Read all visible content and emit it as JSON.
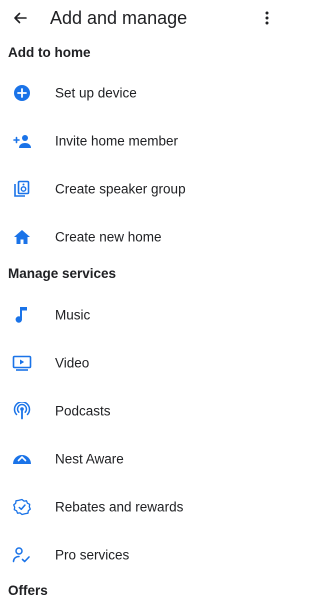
{
  "header": {
    "title": "Add and manage"
  },
  "sections": {
    "add_to_home": "Add to home",
    "manage_services": "Manage services",
    "offers": "Offers"
  },
  "add_items": [
    {
      "label": "Set up device",
      "icon": "add-circle-icon"
    },
    {
      "label": "Invite home member",
      "icon": "person-add-icon"
    },
    {
      "label": "Create speaker group",
      "icon": "speaker-group-icon"
    },
    {
      "label": "Create new home",
      "icon": "home-icon"
    }
  ],
  "service_items": [
    {
      "label": "Music",
      "icon": "music-note-icon"
    },
    {
      "label": "Video",
      "icon": "video-icon"
    },
    {
      "label": "Podcasts",
      "icon": "podcast-icon"
    },
    {
      "label": "Nest Aware",
      "icon": "nest-aware-icon"
    },
    {
      "label": "Rebates and rewards",
      "icon": "rebates-icon"
    },
    {
      "label": "Pro services",
      "icon": "pro-services-icon"
    }
  ],
  "colors": {
    "accent": "#1a73e8",
    "text": "#202124"
  }
}
